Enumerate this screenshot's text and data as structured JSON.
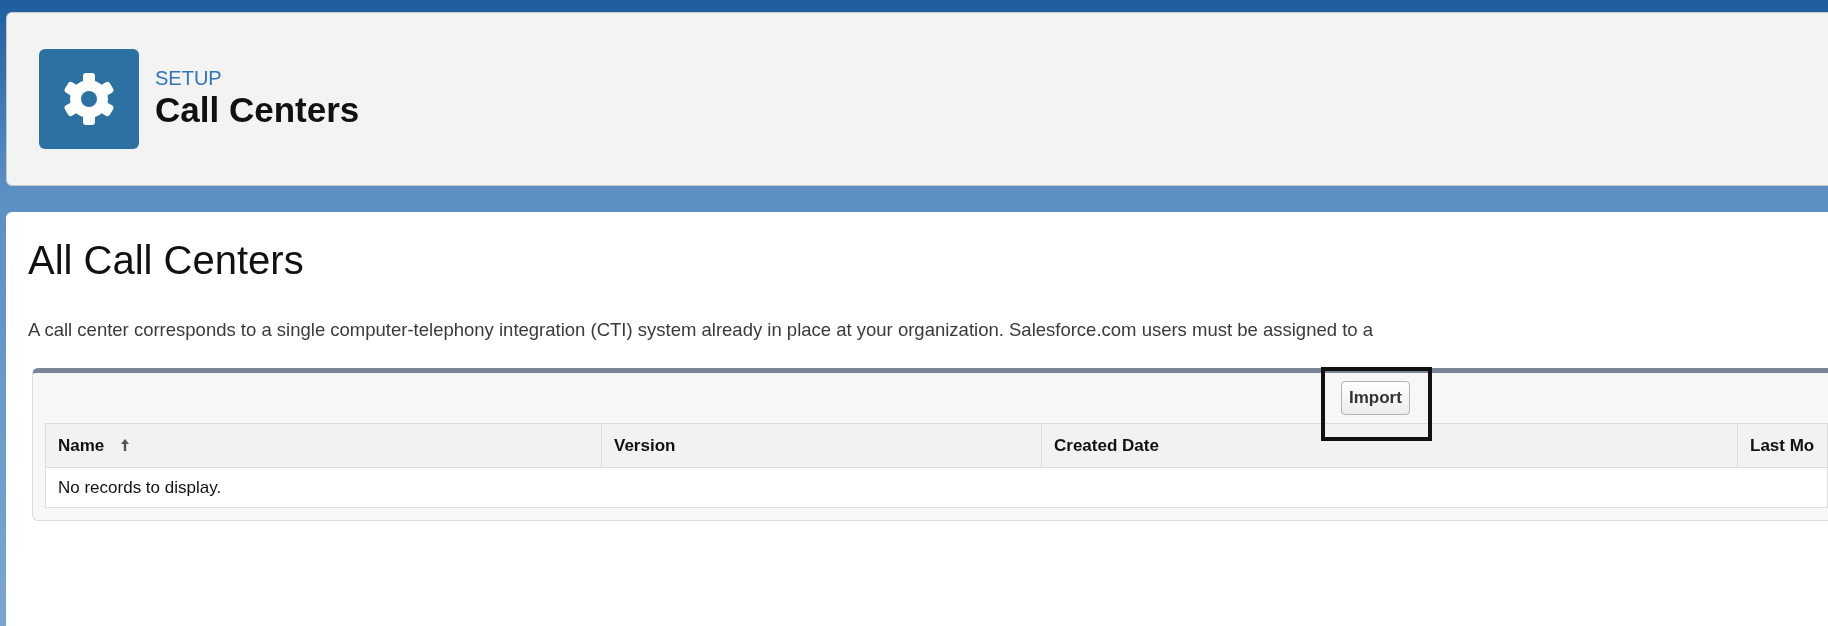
{
  "header": {
    "eyebrow": "SETUP",
    "title": "Call Centers"
  },
  "page": {
    "heading": "All Call Centers",
    "description": "A call center corresponds to a single computer-telephony integration (CTI) system already in place at your organization. Salesforce.com users must be assigned to a"
  },
  "toolbar": {
    "buttons": [
      {
        "label": "Import",
        "highlighted": true
      }
    ]
  },
  "table": {
    "columns": [
      {
        "label": "Name",
        "sorted": true
      },
      {
        "label": "Version",
        "sorted": false
      },
      {
        "label": "Created Date",
        "sorted": false
      },
      {
        "label": "Last Mo",
        "sorted": false
      }
    ],
    "empty_message": "No records to display."
  }
}
